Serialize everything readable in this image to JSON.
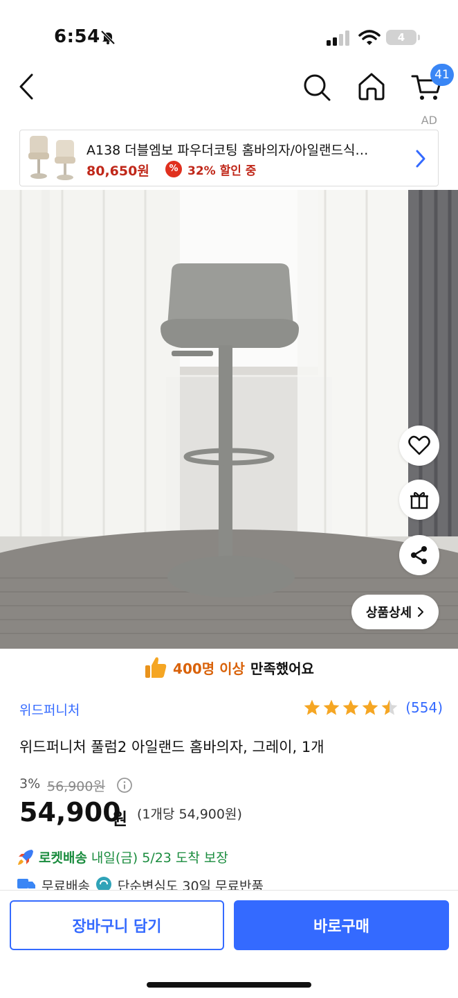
{
  "status_bar": {
    "time": "6:54",
    "battery": "4"
  },
  "header": {
    "cart_count": "41"
  },
  "ad": {
    "label": "AD",
    "title": "A138 더블엠보 파우더코팅 홈바의자/아일랜드식…",
    "price": "80,650원",
    "discount_icon": "%",
    "discount": "32% 할인 중"
  },
  "hero": {
    "detail_button": "상품상세"
  },
  "satisfaction": {
    "highlight": "400명 이상",
    "text": "만족했어요"
  },
  "product": {
    "brand": "위드퍼니처",
    "rating": 4.5,
    "review_count": "(554)",
    "title": "위드퍼니처 풀럼2 아일랜드 홈바의자, 그레이, 1개",
    "discount_rate": "3%",
    "original_price": "56,900원",
    "price": "54,900",
    "price_unit": "원",
    "unit_price": "(1개당 54,900원)"
  },
  "delivery": {
    "rocket_label": "로켓배송",
    "arrival": "내일(금) 5/23 도착 보장",
    "free_shipping": "무료배송",
    "free_return": "단순변심도 30일 무료반품"
  },
  "bottom_bar": {
    "cart_button": "장바구니 담기",
    "buy_button": "바로구매"
  },
  "colors": {
    "accent": "#346aff",
    "rocket": "#1a8c3e",
    "sale": "#c0281a",
    "satisfaction": "#d9620a",
    "star": "#f5a623"
  },
  "icons": [
    "bell-off-icon",
    "signal-icon",
    "wifi-icon",
    "back-icon",
    "search-icon",
    "home-icon",
    "cart-icon",
    "chevron-right-icon",
    "heart-icon",
    "gift-icon",
    "share-icon",
    "thumbs-up-icon",
    "star-icon",
    "info-icon",
    "rocket-icon",
    "truck-icon",
    "return-icon"
  ]
}
